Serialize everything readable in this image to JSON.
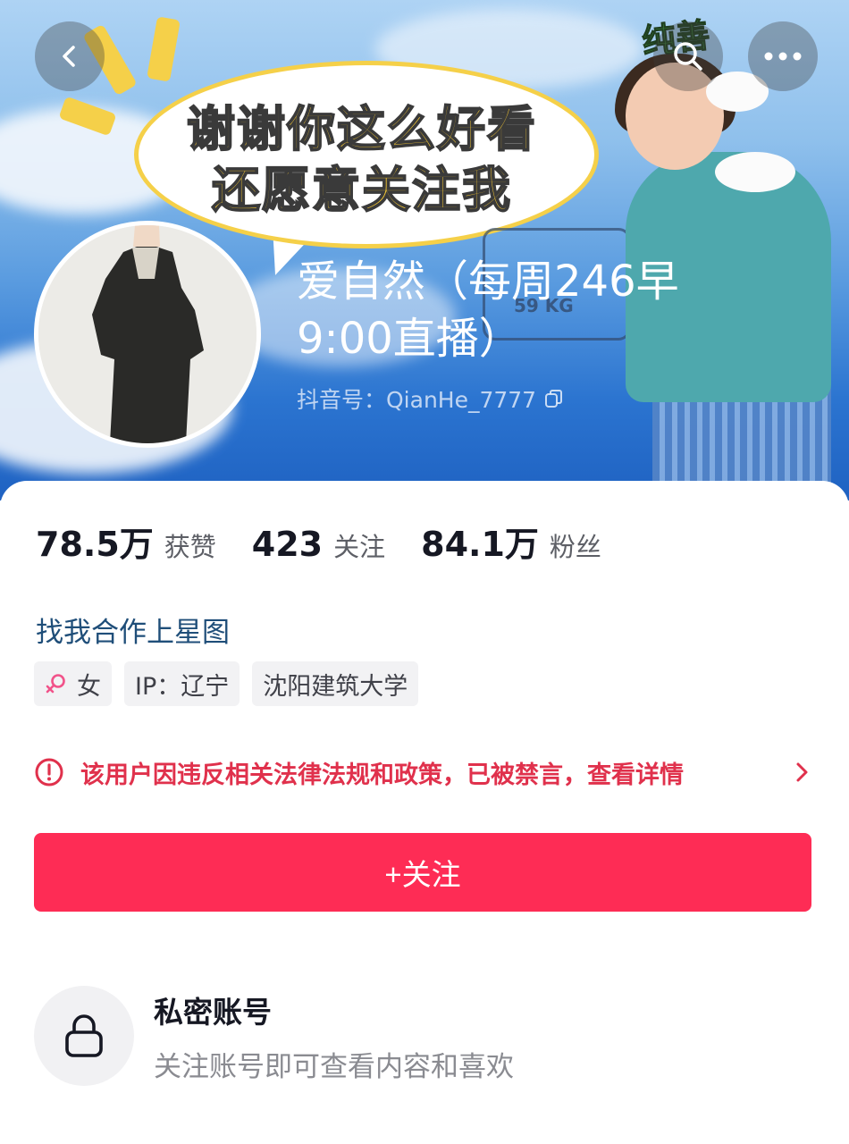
{
  "banner": {
    "bubble_line1": "谢谢你这么好看",
    "bubble_line2": "还愿意关注我",
    "sticker": "纯善",
    "scale_text": "59 KG"
  },
  "header": {
    "back_icon": "chevron-left-icon",
    "search_icon": "search-icon",
    "more_icon": "more-horizontal-icon"
  },
  "profile": {
    "nickname": "爱自然（每周246早9:00直播）",
    "douyin_id": "抖音号：QianHe_7777",
    "copy_icon": "copy-icon"
  },
  "stats": [
    {
      "value": "78.5万",
      "label": "获赞"
    },
    {
      "value": "423",
      "label": "关注"
    },
    {
      "value": "84.1万",
      "label": "粉丝"
    }
  ],
  "collab_link": "找我合作上星图",
  "tags": {
    "gender_icon": "female-icon",
    "gender": "女",
    "ip": "IP：辽宁",
    "school": "沈阳建筑大学"
  },
  "warning": {
    "icon": "alert-circle-icon",
    "text": "该用户因违反相关法律法规和政策，已被禁言，查看详情",
    "arrow_icon": "chevron-right-icon",
    "color": "#e0314c"
  },
  "follow_button": {
    "label": "+关注",
    "color": "#fe2c55"
  },
  "private_account": {
    "icon": "lock-icon",
    "title": "私密账号",
    "description": "关注账号即可查看内容和喜欢"
  }
}
